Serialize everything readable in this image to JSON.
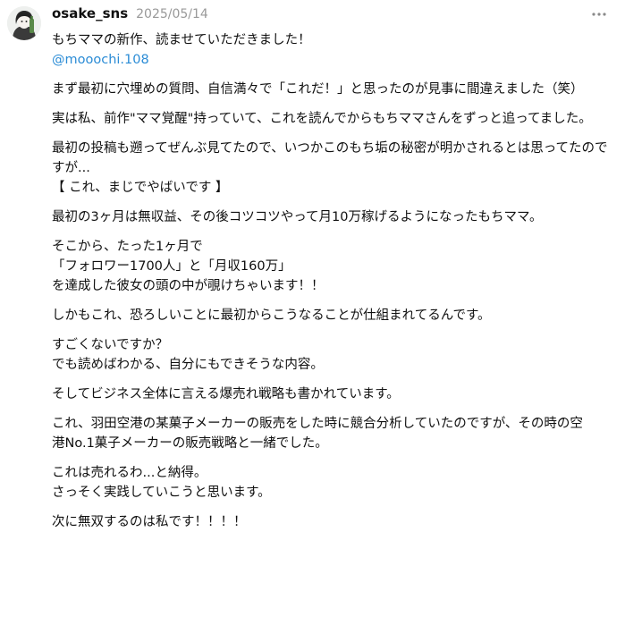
{
  "post": {
    "username": "osake_sns",
    "date": "2025/05/14",
    "more_icon": "more-dots-icon",
    "avatar_icon": "user-avatar"
  },
  "paragraphs": [
    [
      "もちママの新作、読ませていただきました！"
    ],
    [
      "まず最初に穴埋めの質問、自信満々で「これだ！」と思ったのが見事に間違えました（笑）"
    ],
    [
      "実は私、前作\"ママ覚醒\"持っていて、これを読んでからもちママさんをずっと追ってました。"
    ],
    [
      "最初の投稿も遡ってぜんぶ見てたので、いつかこのもち垢の秘密が明かされるとは思ってたので",
      "すが...",
      "【 これ、まじでやばいです 】"
    ],
    [
      "最初の3ヶ月は無収益、その後コツコツやって月10万稼げるようになったもちママ。"
    ],
    [
      "そこから、たった1ヶ月で",
      "「フォロワー1700人」と「月収160万」",
      "を達成した彼女の頭の中が覗けちゃいます！！"
    ],
    [
      "しかもこれ、恐ろしいことに最初からこうなることが仕組まれてるんです。"
    ],
    [
      "すごくないですか？",
      "でも読めばわかる、自分にもできそうな内容。"
    ],
    [
      "そしてビジネス全体に言える爆売れ戦略も書かれています。"
    ],
    [
      "これ、羽田空港の某菓子メーカーの販売をした時に競合分析していたのですが、その時の空",
      "港No.1菓子メーカーの販売戦略と一緒でした。"
    ],
    [
      "これは売れるわ...と納得。",
      "さっそく実践していこうと思います。"
    ],
    [
      "次に無双するのは私です！！！！"
    ]
  ],
  "mention": "@mooochi.108",
  "colors": {
    "text": "#101010",
    "muted": "#999999",
    "link": "#2b8cd6"
  }
}
